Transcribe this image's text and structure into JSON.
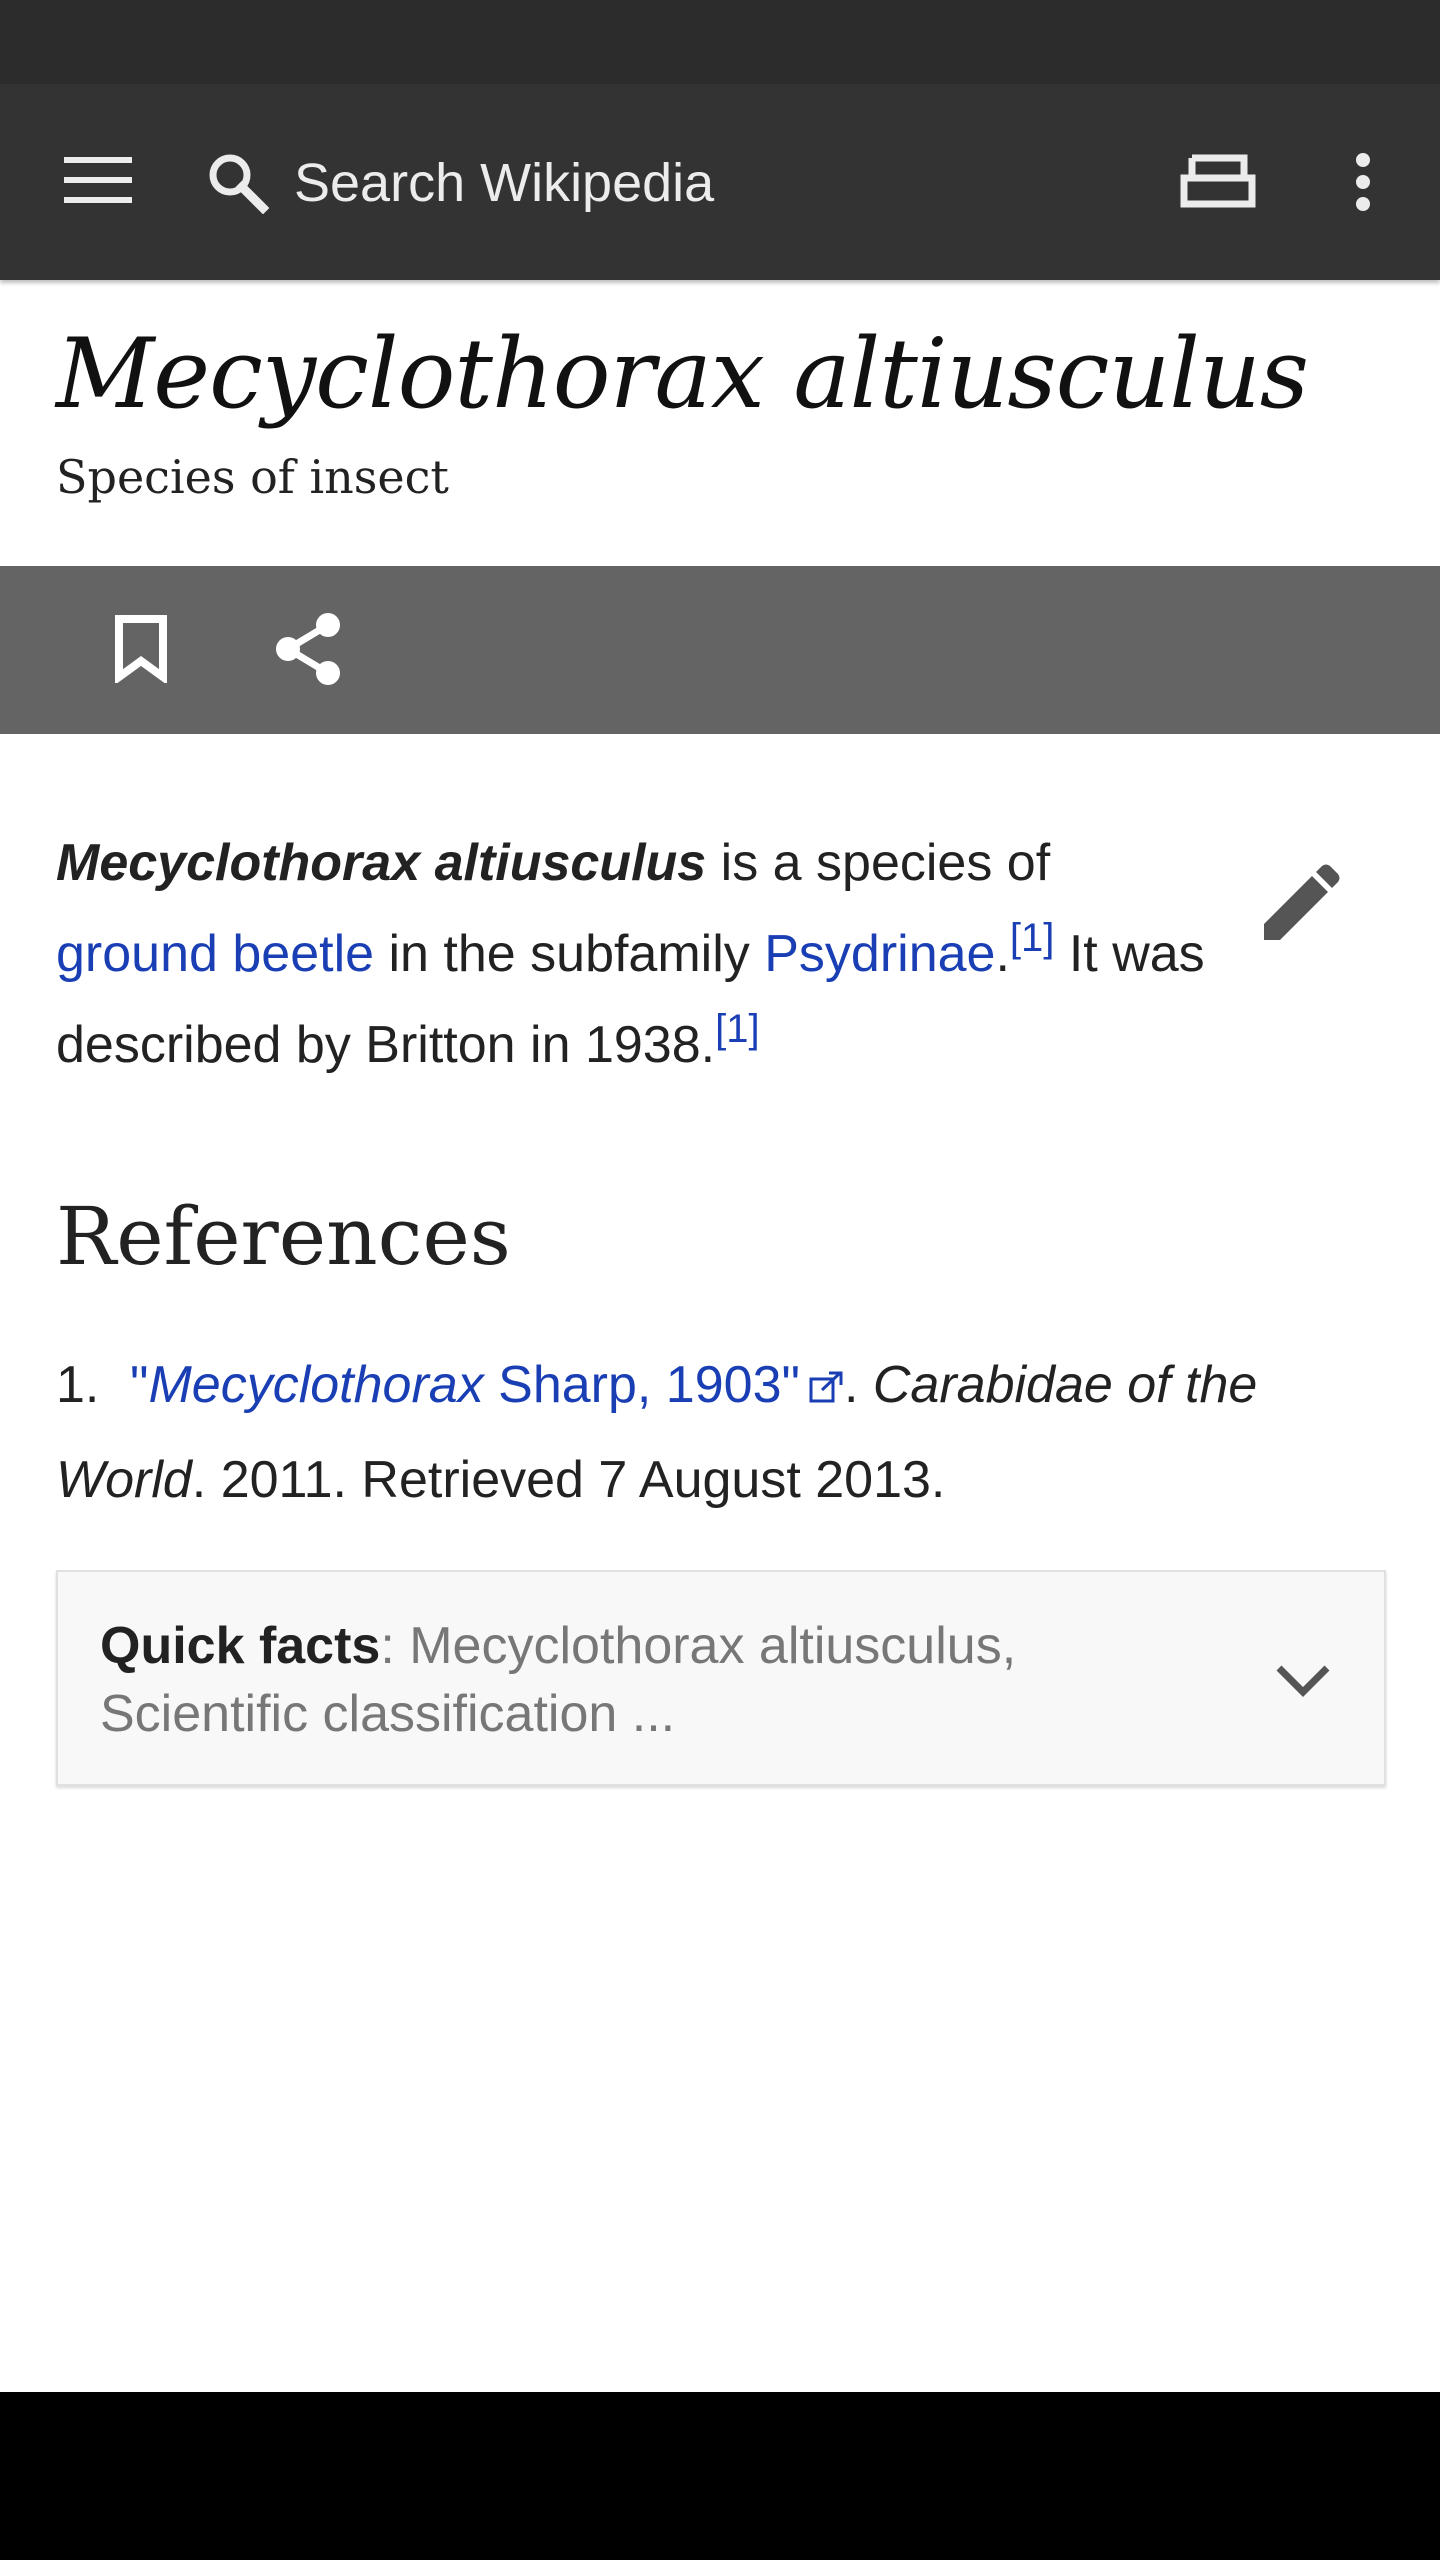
{
  "toolbar": {
    "search_placeholder": "Search Wikipedia"
  },
  "article": {
    "title": "Mecyclothorax altiusculus",
    "description": "Species of insect",
    "lead": {
      "subject": "Mecyclothorax altiusculus",
      "t1": " is a species of ",
      "link1": "ground beetle",
      "t2": " in the subfamily ",
      "link2": "Psydrinae",
      "t3": ".",
      "ref1": "[1]",
      "t4": " It was described by Britton in 1938.",
      "ref2": "[1]"
    },
    "references": {
      "heading": "References",
      "items": [
        {
          "number": "1.",
          "link_italic": "Mecyclothorax",
          "link_rest": " Sharp, 1903",
          "quote_open": "\"",
          "quote_close": "\"",
          "after_link": ". ",
          "work": "Carabidae of the World",
          "tail": ". 2011. Retrieved 7 August 2013."
        }
      ]
    },
    "quick_facts": {
      "label": "Quick facts",
      "summary": ": Mecyclothorax altiusculus, Scientific classification ..."
    }
  },
  "colors": {
    "toolbar": "#333333",
    "actionbar": "#646464",
    "link": "#1a3fb4"
  }
}
